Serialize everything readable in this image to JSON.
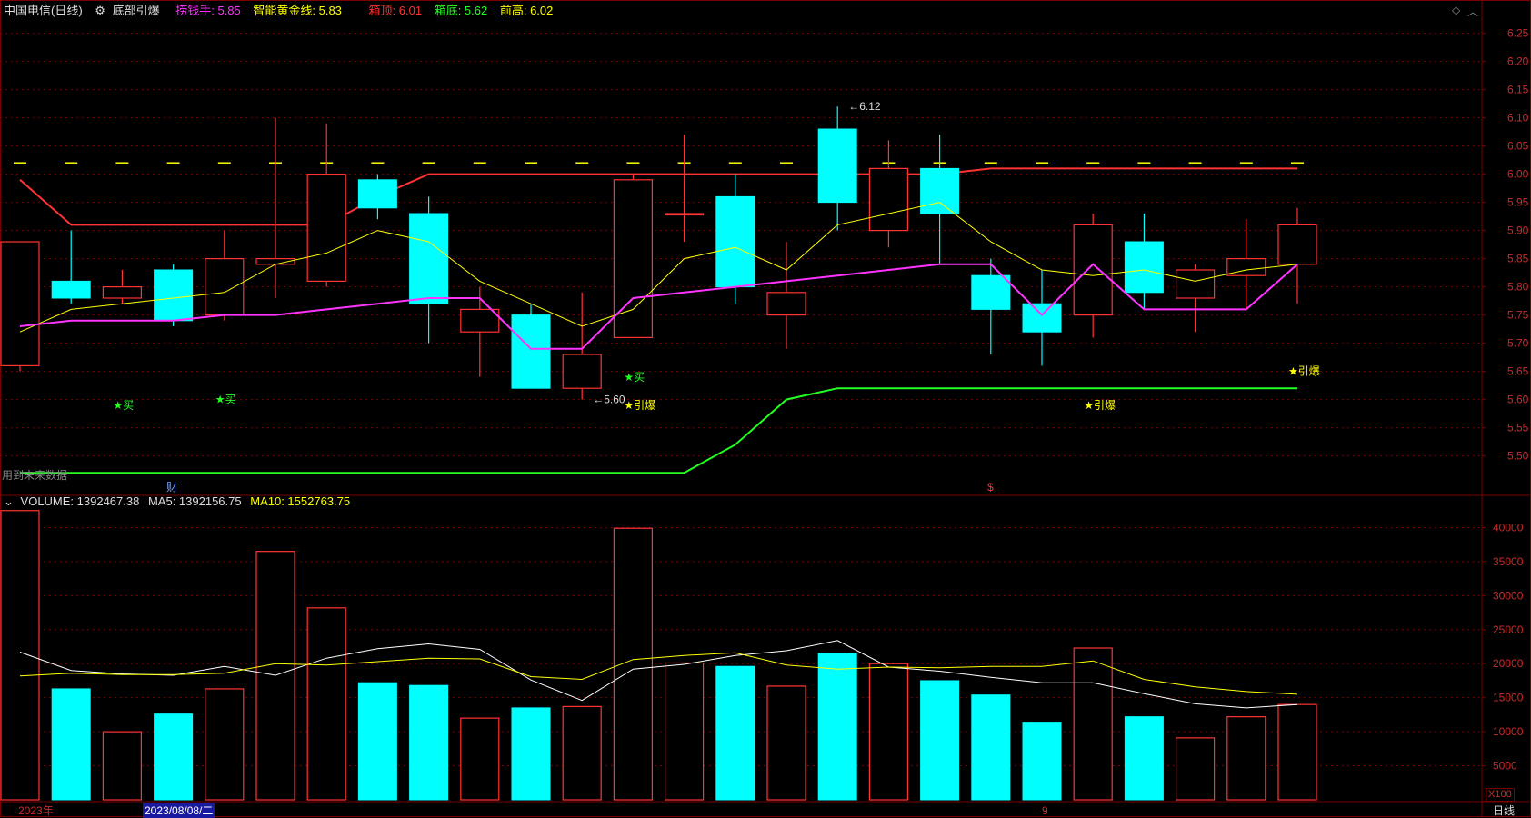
{
  "window": {
    "stock_name": "中国电信(日线)",
    "indicator_name": "底部引爆",
    "indicators": [
      {
        "label": "捞钱手: 5.85",
        "color": "#ff33ff"
      },
      {
        "label": "智能黄金线: 5.83",
        "color": "#ffff00"
      },
      {
        "label": "箱顶: 6.01",
        "color": "#ff3333"
      },
      {
        "label": "箱底: 5.62",
        "color": "#22ff22"
      },
      {
        "label": "前高: 6.02",
        "color": "#ffff00"
      }
    ],
    "future_data_label": "用到未来数据",
    "fin_marker": "财",
    "dividend_marker": "$"
  },
  "volume_header": {
    "volume_label": "VOLUME: 1392467.38",
    "ma5_label": "MA5: 1392156.75",
    "ma10_label": "MA10: 1552763.75"
  },
  "bottom_bar": {
    "year_label": "2023年",
    "date_label": "2023/08/08/二",
    "month_label": "9",
    "multiplier_label": "X100",
    "period_label": "日线"
  },
  "colors": {
    "up": "#ff3333",
    "down": "#00ffff",
    "ma_white": "#ffffff",
    "ma_yellow": "#ffff00",
    "box_bottom": "#22ff22",
    "money_line": "#ff33ff",
    "axis_text": "#cc2a2a",
    "grid": "#7a0000"
  },
  "chart_data": [
    {
      "type": "candlestick",
      "title": "中国电信(日线)",
      "ylim": [
        5.43,
        6.28
      ],
      "y_ticks": [
        5.5,
        5.55,
        5.6,
        5.65,
        5.7,
        5.75,
        5.8,
        5.85,
        5.9,
        5.95,
        6.0,
        6.05,
        6.1,
        6.15,
        6.2,
        6.25
      ],
      "candles": [
        {
          "o": 5.66,
          "c": 5.88,
          "h": 5.88,
          "l": 5.65
        },
        {
          "o": 5.81,
          "c": 5.78,
          "h": 5.9,
          "l": 5.77
        },
        {
          "o": 5.78,
          "c": 5.8,
          "h": 5.83,
          "l": 5.77
        },
        {
          "o": 5.83,
          "c": 5.74,
          "h": 5.84,
          "l": 5.73
        },
        {
          "o": 5.75,
          "c": 5.85,
          "h": 5.9,
          "l": 5.74
        },
        {
          "o": 5.84,
          "c": 5.85,
          "h": 6.1,
          "l": 5.78
        },
        {
          "o": 5.81,
          "c": 6.0,
          "h": 6.09,
          "l": 5.8
        },
        {
          "o": 5.99,
          "c": 5.94,
          "h": 6.0,
          "l": 5.92
        },
        {
          "o": 5.93,
          "c": 5.77,
          "h": 5.96,
          "l": 5.7
        },
        {
          "o": 5.72,
          "c": 5.76,
          "h": 5.8,
          "l": 5.64
        },
        {
          "o": 5.75,
          "c": 5.62,
          "h": 5.77,
          "l": 5.62
        },
        {
          "o": 5.62,
          "c": 5.68,
          "h": 5.79,
          "l": 5.6
        },
        {
          "o": 5.71,
          "c": 5.99,
          "h": 6.0,
          "l": 5.71
        },
        {
          "o": 5.93,
          "c": 5.93,
          "h": 6.07,
          "l": 5.88
        },
        {
          "o": 5.96,
          "c": 5.8,
          "h": 6.0,
          "l": 5.77
        },
        {
          "o": 5.75,
          "c": 5.79,
          "h": 5.88,
          "l": 5.69
        },
        {
          "o": 6.08,
          "c": 5.95,
          "h": 6.12,
          "l": 5.9
        },
        {
          "o": 5.9,
          "c": 6.01,
          "h": 6.06,
          "l": 5.87
        },
        {
          "o": 6.01,
          "c": 5.93,
          "h": 6.07,
          "l": 5.84
        },
        {
          "o": 5.82,
          "c": 5.76,
          "h": 5.85,
          "l": 5.68
        },
        {
          "o": 5.77,
          "c": 5.72,
          "h": 5.83,
          "l": 5.66
        },
        {
          "o": 5.75,
          "c": 5.91,
          "h": 5.93,
          "l": 5.71
        },
        {
          "o": 5.88,
          "c": 5.79,
          "h": 5.93,
          "l": 5.76
        },
        {
          "o": 5.78,
          "c": 5.83,
          "h": 5.84,
          "l": 5.72
        },
        {
          "o": 5.82,
          "c": 5.85,
          "h": 5.92,
          "l": 5.76
        },
        {
          "o": 5.84,
          "c": 5.91,
          "h": 5.94,
          "l": 5.77
        }
      ],
      "series": [
        {
          "name": "智能黄金线",
          "color": "#ffff00",
          "values": [
            5.72,
            5.76,
            5.77,
            5.78,
            5.79,
            5.84,
            5.86,
            5.9,
            5.88,
            5.81,
            5.77,
            5.73,
            5.76,
            5.85,
            5.87,
            5.83,
            5.91,
            5.93,
            5.95,
            5.88,
            5.83,
            5.82,
            5.83,
            5.81,
            5.83,
            5.84
          ]
        },
        {
          "name": "捞钱手",
          "color": "#ff33ff",
          "values": [
            5.73,
            5.74,
            5.74,
            5.74,
            5.75,
            5.75,
            5.76,
            5.77,
            5.78,
            5.78,
            5.69,
            5.69,
            5.78,
            5.79,
            5.8,
            5.81,
            5.82,
            5.83,
            5.84,
            5.84,
            5.75,
            5.84,
            5.76,
            5.76,
            5.76,
            5.84
          ]
        },
        {
          "name": "箱顶",
          "color": "#ff3333",
          "values": [
            5.99,
            5.91,
            5.91,
            5.91,
            5.91,
            5.91,
            5.91,
            5.96,
            6.0,
            6.0,
            6.0,
            6.0,
            6.0,
            6.0,
            6.0,
            6.0,
            6.0,
            6.0,
            6.0,
            6.01,
            6.01,
            6.01,
            6.01,
            6.01,
            6.01,
            6.01
          ]
        },
        {
          "name": "箱底",
          "color": "#22ff22",
          "values": [
            5.47,
            5.47,
            5.47,
            5.47,
            5.47,
            5.47,
            5.47,
            5.47,
            5.47,
            5.47,
            5.47,
            5.47,
            5.47,
            5.47,
            5.52,
            5.6,
            5.62,
            5.62,
            5.62,
            5.62,
            5.62,
            5.62,
            5.62,
            5.62,
            5.62,
            5.62
          ]
        },
        {
          "name": "前高",
          "color": "#ffff00",
          "values": [
            6.02,
            6.02,
            6.02,
            6.02,
            6.02,
            6.02,
            6.02,
            6.02,
            6.02,
            6.02,
            6.02,
            6.02,
            6.02,
            6.02,
            6.02,
            6.02,
            6.02,
            6.02,
            6.02,
            6.02,
            6.02,
            6.02,
            6.02,
            6.02,
            6.02,
            6.02
          ]
        }
      ],
      "annotations": [
        {
          "label": "6.12",
          "index": 16,
          "price": 6.12
        },
        {
          "label": "5.60",
          "index": 11,
          "price": 5.6
        }
      ],
      "signals": [
        {
          "label": "★买",
          "index": 2,
          "price": 5.59,
          "color": "#22ff22"
        },
        {
          "label": "★买",
          "index": 4,
          "price": 5.6,
          "color": "#22ff22"
        },
        {
          "label": "★买",
          "index": 12,
          "price": 5.64,
          "color": "#22ff22"
        },
        {
          "label": "★引爆",
          "index": 12,
          "price": 5.59,
          "color": "#ffff00"
        },
        {
          "label": "★引爆",
          "index": 21,
          "price": 5.59,
          "color": "#ffff00"
        },
        {
          "label": "★引爆",
          "index": 25,
          "price": 5.65,
          "color": "#ffff00"
        }
      ]
    },
    {
      "type": "bar",
      "title": "VOLUME",
      "ylim": [
        0,
        43000
      ],
      "y_ticks": [
        5000,
        10000,
        15000,
        20000,
        25000,
        30000,
        35000,
        40000
      ],
      "values": [
        42500,
        16300,
        10000,
        12600,
        16300,
        36500,
        28200,
        17200,
        16800,
        12000,
        13500,
        13700,
        39900,
        20100,
        19600,
        16700,
        21500,
        20000,
        17500,
        15400,
        11400,
        22300,
        12200,
        9100,
        12200,
        14000
      ],
      "series": [
        {
          "name": "MA5",
          "color": "#ffffff",
          "values": [
            21700,
            19000,
            18500,
            18300,
            19600,
            18300,
            20800,
            22200,
            22900,
            22100,
            17600,
            14600,
            19200,
            19900,
            21200,
            21900,
            23400,
            19500,
            18900,
            18000,
            17200,
            17200,
            15600,
            14100,
            13500,
            14000
          ]
        },
        {
          "name": "MA10",
          "color": "#ffff00",
          "values": [
            18200,
            18600,
            18400,
            18400,
            18600,
            20000,
            19800,
            20300,
            20800,
            20700,
            18100,
            17700,
            20600,
            21200,
            21600,
            19800,
            19200,
            19500,
            19400,
            19600,
            19600,
            20400,
            17700,
            16600,
            15900,
            15500
          ]
        }
      ]
    }
  ]
}
